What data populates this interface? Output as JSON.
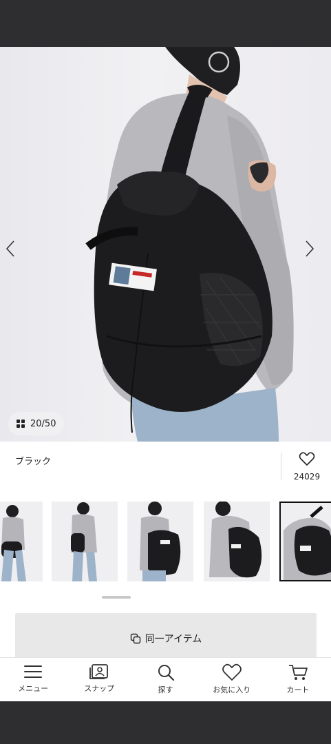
{
  "gallery": {
    "counter": "20/50",
    "prev_icon": "chevron-left-icon",
    "next_icon": "chevron-right-icon"
  },
  "product": {
    "color_name": "ブラック",
    "favorite_count": "24029"
  },
  "thumbnails": [
    {
      "id": "thumb-1",
      "selected": false
    },
    {
      "id": "thumb-2",
      "selected": false
    },
    {
      "id": "thumb-3",
      "selected": false
    },
    {
      "id": "thumb-4",
      "selected": false
    },
    {
      "id": "thumb-5",
      "selected": true
    }
  ],
  "same_item": {
    "label": "同一アイテム",
    "icon": "copy-icon"
  },
  "nav": {
    "items": [
      {
        "label": "メニュー",
        "icon": "menu-icon"
      },
      {
        "label": "スナップ",
        "icon": "snap-icon"
      },
      {
        "label": "探す",
        "icon": "search-icon"
      },
      {
        "label": "お気に入り",
        "icon": "heart-icon"
      },
      {
        "label": "カート",
        "icon": "cart-icon"
      }
    ]
  },
  "colors": {
    "accent": "#222222",
    "bag": "#1c1c1e",
    "sweater": "#b9b8bc"
  }
}
